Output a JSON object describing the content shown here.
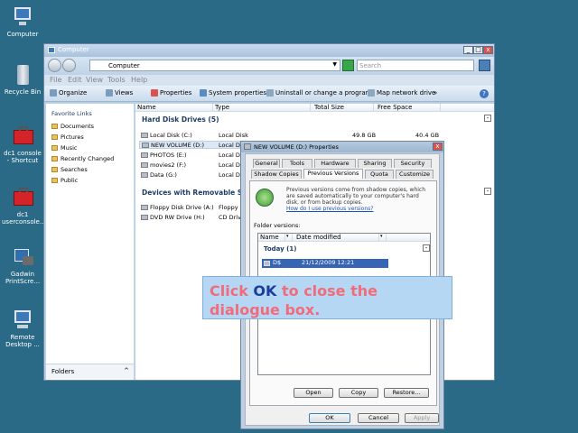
{
  "desktop": {
    "icons": [
      {
        "label": "Computer",
        "icon": "computer-icon"
      },
      {
        "label": "Recycle Bin",
        "icon": "recycle-bin-icon"
      },
      {
        "label": "dc1 console - Shortcut",
        "icon": "toolbox-icon"
      },
      {
        "label": "dc1 userconsole....",
        "icon": "toolbox-icon"
      },
      {
        "label": "Gadwin PrintScre...",
        "icon": "camera-icon"
      },
      {
        "label": "Remote Desktop ...",
        "icon": "remote-desktop-icon"
      }
    ]
  },
  "explorer": {
    "title": "Computer",
    "address": "Computer",
    "search_placeholder": "Search",
    "menu": [
      "File",
      "Edit",
      "View",
      "Tools",
      "Help"
    ],
    "toolbar": [
      "Organize",
      "Views",
      "Properties",
      "System properties",
      "Uninstall or change a program",
      "Map network drive",
      "»"
    ],
    "nav": {
      "header": "Favorite Links",
      "items": [
        "Documents",
        "Pictures",
        "Music",
        "Recently Changed",
        "Searches",
        "Public"
      ],
      "folders_label": "Folders"
    },
    "columns": [
      "Name",
      "Type",
      "Total Size",
      "Free Space"
    ],
    "groups": {
      "hdd": "Hard Disk Drives (5)",
      "removable": "Devices with Removable Stora"
    },
    "drives": [
      {
        "name": "Local Disk (C:)",
        "type": "Local Disk",
        "total": "49.8 GB",
        "free": "40.4 GB"
      },
      {
        "name": "NEW VOLUME (D:)",
        "type": "Local Di",
        "total": "",
        "free": ""
      },
      {
        "name": "PHOTOS (E:)",
        "type": "Local Di",
        "total": "",
        "free": ""
      },
      {
        "name": "movies2 (F:)",
        "type": "Local Di",
        "total": "",
        "free": ""
      },
      {
        "name": "Data (G:)",
        "type": "Local Di",
        "total": "",
        "free": ""
      }
    ],
    "removable": [
      {
        "name": "Floppy Disk Drive (A:)",
        "type": "Floppy D"
      },
      {
        "name": "DVD RW Drive (H:)",
        "type": "CD Driv"
      }
    ]
  },
  "dialog": {
    "title": "NEW VOLUME (D:) Properties",
    "tabs_row1": [
      "General",
      "Tools",
      "Hardware",
      "Sharing",
      "Security"
    ],
    "tabs_row2": [
      "Shadow Copies",
      "Previous Versions",
      "Quota",
      "Customize"
    ],
    "description": "Previous versions come from shadow copies, which are saved automatically to your computer's hard disk, or from backup copies.",
    "help_link": "How do I use previous versions?",
    "folder_versions_label": "Folder versions:",
    "list_columns": [
      "Name",
      "Date modified"
    ],
    "group": "Today (1)",
    "entry": {
      "name": "D$",
      "date": "21/12/2009 12:21"
    },
    "buttons": {
      "open": "Open",
      "copy": "Copy",
      "restore": "Restore...",
      "ok": "OK",
      "cancel": "Cancel",
      "apply": "Apply"
    }
  },
  "callout": {
    "before": "Click ",
    "ok": "OK",
    "after": " to close the dialogue box."
  }
}
